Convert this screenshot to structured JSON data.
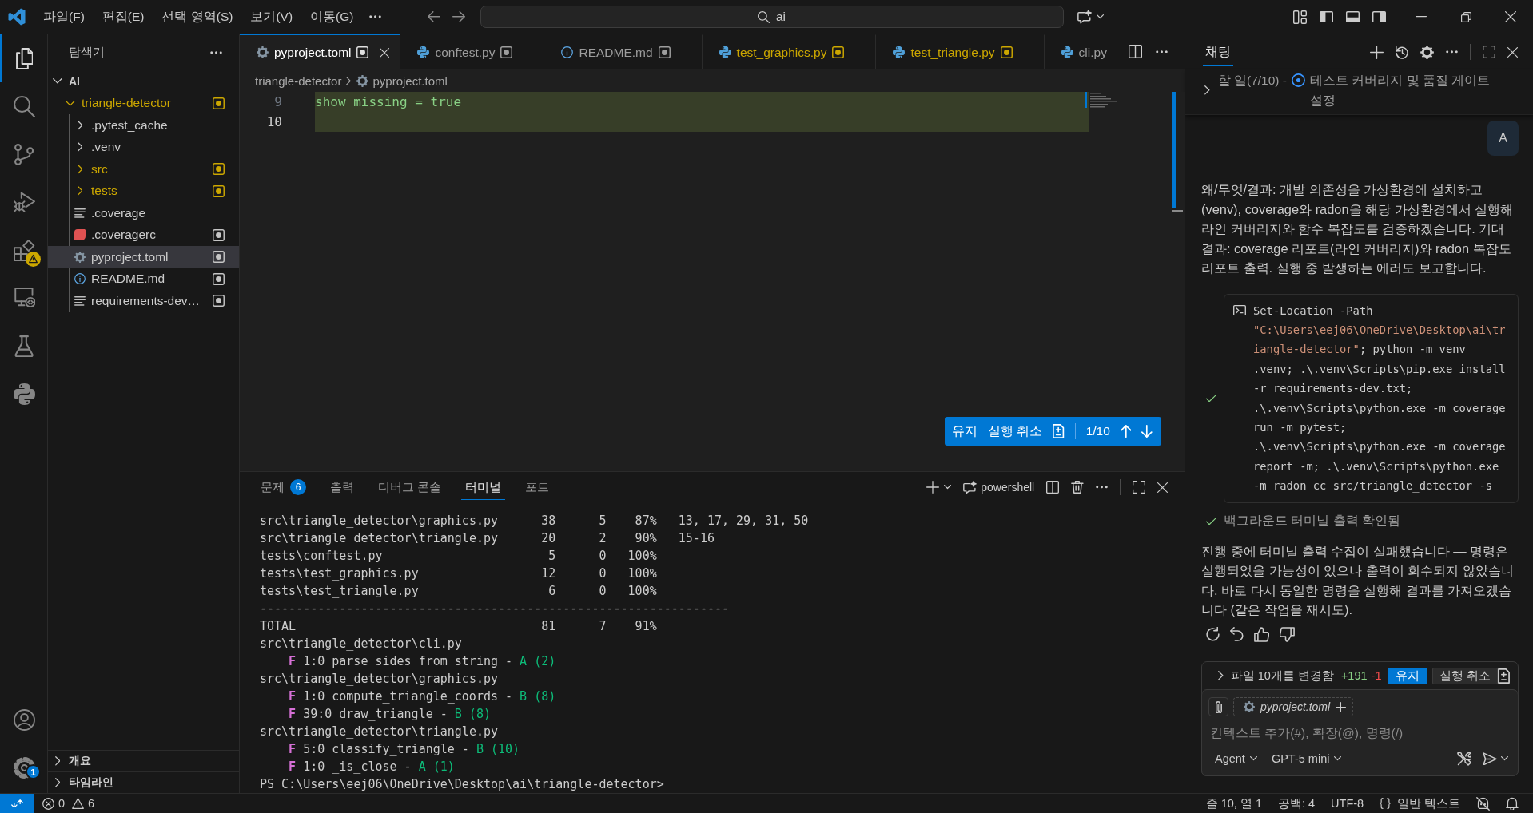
{
  "title_bar": {
    "menus": [
      "파일(F)",
      "편집(E)",
      "선택 영역(S)",
      "보기(V)",
      "이동(G)"
    ],
    "search": {
      "value": "ai"
    }
  },
  "activity_bar": {
    "items": [
      {
        "kind": "explorer",
        "selected": true
      },
      {
        "kind": "search",
        "selected": false
      },
      {
        "kind": "source_control",
        "selected": false
      },
      {
        "kind": "run_debug",
        "selected": false
      },
      {
        "kind": "extensions",
        "selected": false,
        "badge": {
          "kind": "warning"
        }
      },
      {
        "kind": "remote",
        "selected": false
      },
      {
        "kind": "testing",
        "selected": false
      },
      {
        "kind": "python",
        "selected": false
      }
    ],
    "bottom_items": [
      {
        "kind": "accounts"
      },
      {
        "kind": "manage",
        "badge": {
          "kind": "count",
          "text": "1"
        }
      }
    ]
  },
  "explorer": {
    "title": "탐색기",
    "root": {
      "label": "AI",
      "expanded": true
    },
    "tree": [
      {
        "label": "triangle-detector",
        "kind": "folder",
        "expanded": true,
        "warning": true,
        "marker": true,
        "selected": false,
        "children": [
          {
            "label": ".pytest_cache",
            "kind": "folder",
            "expanded": false,
            "warning": false,
            "marker": false,
            "selected": false
          },
          {
            "label": ".venv",
            "kind": "folder",
            "expanded": false,
            "warning": false,
            "marker": false,
            "selected": false
          },
          {
            "label": "src",
            "kind": "folder",
            "expanded": false,
            "warning": true,
            "marker": true,
            "selected": false
          },
          {
            "label": "tests",
            "kind": "folder",
            "expanded": false,
            "warning": true,
            "marker": true,
            "selected": false
          },
          {
            "label": ".coverage",
            "kind": "text",
            "warning": false,
            "marker": false,
            "selected": false
          },
          {
            "label": ".coveragerc",
            "kind": "coverage",
            "warning": false,
            "marker": true,
            "selected": false
          },
          {
            "label": "pyproject.toml",
            "kind": "config",
            "warning": false,
            "marker": true,
            "selected": true
          },
          {
            "label": "README.md",
            "kind": "info",
            "warning": false,
            "marker": true,
            "selected": false
          },
          {
            "label": "requirements-dev…",
            "kind": "text",
            "warning": false,
            "marker": true,
            "selected": false
          }
        ]
      }
    ],
    "sections": [
      {
        "label": "개요",
        "expanded": false
      },
      {
        "label": "타임라인",
        "expanded": false
      }
    ]
  },
  "editor": {
    "tabs": [
      {
        "label": "pyproject.toml",
        "kind": "config",
        "warning": false,
        "marker": true,
        "selected": true
      },
      {
        "label": "conftest.py",
        "kind": "python",
        "warning": false,
        "marker": true,
        "selected": false
      },
      {
        "label": "README.md",
        "kind": "info",
        "warning": false,
        "marker": true,
        "selected": false
      },
      {
        "label": "test_graphics.py",
        "kind": "python",
        "warning": true,
        "marker": true,
        "selected": false
      },
      {
        "label": "test_triangle.py",
        "kind": "python",
        "warning": true,
        "marker": true,
        "selected": false
      },
      {
        "label": "cli.py",
        "kind": "python",
        "warning": false,
        "marker": false,
        "selected": false
      }
    ],
    "breadcrumb": [
      {
        "label": "triangle-detector",
        "kind": "folder"
      },
      {
        "label": "pyproject.toml",
        "kind": "config"
      }
    ],
    "lines": [
      {
        "number": "9",
        "text": "show_missing = true",
        "added": true,
        "current": false
      },
      {
        "number": "10",
        "added": true,
        "current": true
      }
    ],
    "review": {
      "keep": "유지",
      "undo": "실행 취소",
      "counter": "1/10"
    }
  },
  "panel": {
    "tabs": [
      {
        "label": "문제",
        "badge": "6",
        "selected": false
      },
      {
        "label": "출력",
        "selected": false
      },
      {
        "label": "디버그 콘솔",
        "selected": false
      },
      {
        "label": "터미널",
        "selected": true
      },
      {
        "label": "포트",
        "selected": false
      }
    ],
    "shell": "powershell",
    "terminal": [
      {
        "kind": "text",
        "text": "src\\triangle_detector\\graphics.py      38      5    87%   13, 17, 29, 31, 50"
      },
      {
        "kind": "text",
        "text": "src\\triangle_detector\\triangle.py      20      2    90%   15-16"
      },
      {
        "kind": "text",
        "text": "tests\\conftest.py                       5      0   100%"
      },
      {
        "kind": "text",
        "text": "tests\\test_graphics.py                 12      0   100%"
      },
      {
        "kind": "text",
        "text": "tests\\test_triangle.py                  6      0   100%"
      },
      {
        "kind": "text",
        "text": "-----------------------------------------------------------------"
      },
      {
        "kind": "text",
        "text": "TOTAL                                  81      7    91%"
      },
      {
        "kind": "text",
        "text": "src\\triangle_detector\\cli.py"
      },
      {
        "kind": "radon",
        "type": "F",
        "entry": "1:0 parse_sides_from_string -",
        "grade": "A (2)"
      },
      {
        "kind": "text",
        "text": "src\\triangle_detector\\graphics.py"
      },
      {
        "kind": "radon",
        "type": "F",
        "entry": "1:0 compute_triangle_coords -",
        "grade": "B (8)"
      },
      {
        "kind": "radon",
        "type": "F",
        "entry": "39:0 draw_triangle -",
        "grade": "B (8)"
      },
      {
        "kind": "text",
        "text": "src\\triangle_detector\\triangle.py"
      },
      {
        "kind": "radon",
        "type": "F",
        "entry": "5:0 classify_triangle -",
        "grade": "B (10)"
      },
      {
        "kind": "radon",
        "type": "F",
        "entry": "1:0 _is_close -",
        "grade": "A (1)"
      },
      {
        "kind": "text",
        "text": "PS C:\\Users\\eej06\\OneDrive\\Desktop\\ai\\triangle-detector>"
      }
    ]
  },
  "chat": {
    "tabs": [
      {
        "label": "채팅",
        "selected": true
      }
    ],
    "todo": {
      "label": "할 일(7/10) -",
      "current": "테스트 커버리지 및 품질 게이트 설정",
      "expanded": false
    },
    "messages": [
      {
        "kind": "user",
        "text": "A"
      },
      {
        "kind": "text",
        "text": "왜/무엇/결과: 개발 의존성을 가상환경에 설치하고 (venv), coverage와 radon을 해당 가상환경에서 실행해 라인 커버리지와 함수 복잡도를 검증하겠습니다. 기대 결과: coverage 리포트(라인 커버리지)와 radon 복잡도 리포트 출력. 실행 중 발생하는 에러도 보고합니다."
      },
      {
        "kind": "command",
        "done": true,
        "segments": [
          {
            "kind": "plain",
            "text": "Set-Location -Path "
          },
          {
            "kind": "string",
            "text": "\"C:\\Users\\eej06\\OneDrive\\Desktop\\ai\\triangle-detector\""
          },
          {
            "kind": "plain",
            "text": "; python -m venv .venv; .\\.venv\\Scripts\\pip.exe install -r requirements-dev.txt; .\\.venv\\Scripts\\python.exe -m coverage run -m pytest; .\\.venv\\Scripts\\python.exe -m coverage report -m; .\\.venv\\Scripts\\python.exe -m radon cc src/triangle_detector -s"
          }
        ]
      },
      {
        "kind": "status",
        "done": true,
        "text": "백그라운드 터미널 출력 확인됨"
      },
      {
        "kind": "text",
        "text": "진행 중에 터미널 출력 수집이 실패했습니다 — 명령은 실행되었을 가능성이 있으나 출력이 회수되지 않았습니다. 바로 다시 동일한 명령을 실행해 결과를 가져오겠습니다 (같은 작업을 재시도)."
      }
    ],
    "changes": {
      "label": "파일 10개를 변경함",
      "added": "+191",
      "removed": "-1",
      "keep": "유지",
      "undo": "실행 취소",
      "expanded": false
    },
    "input": {
      "attachment": "pyproject.toml",
      "placeholder": "컨텍스트 추가(#), 확장(@), 명령(/)",
      "mode": "Agent",
      "model": "GPT-5 mini"
    }
  },
  "status_bar": {
    "errors": "0",
    "warnings": "6",
    "items": [
      "줄 10, 열 1",
      "공백: 4",
      "UTF-8"
    ],
    "language": "일반 텍스트"
  }
}
